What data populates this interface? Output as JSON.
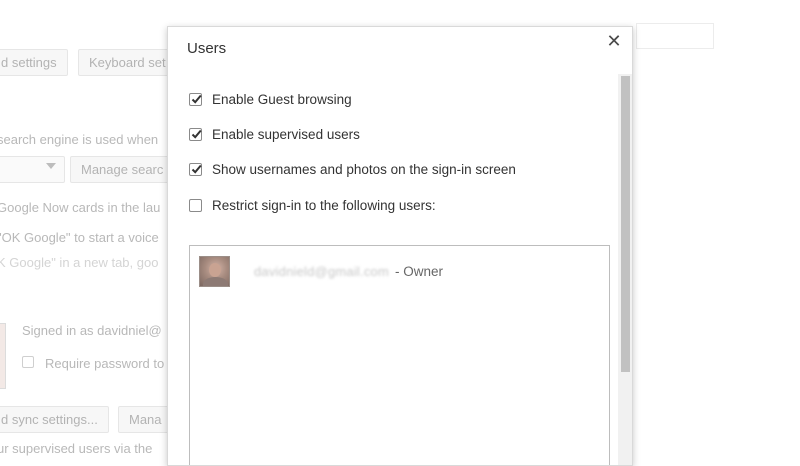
{
  "background": {
    "btn_sync_settings": "d settings",
    "btn_keyboard_settings": "Keyboard set",
    "search_engine_text": "search engine is used when",
    "btn_manage_search": "Manage searc",
    "google_now_text": "Google Now cards in the lau",
    "ok_google_text_1": "\"OK Google\" to start a voice",
    "ok_google_text_2": "K Google\" in a new tab, goo",
    "signed_in_text": "Signed in as davidniel@",
    "require_password_text": "Require password to",
    "btn_advanced_sync": "d sync settings...",
    "btn_manage": "Mana",
    "supervised_text": "ur supervised users via the"
  },
  "dialog": {
    "title": "Users",
    "close_symbol": "✕",
    "options": [
      {
        "label": "Enable Guest browsing",
        "checked": true
      },
      {
        "label": "Enable supervised users",
        "checked": true
      },
      {
        "label": "Show usernames and photos on the sign-in screen",
        "checked": true
      },
      {
        "label": "Restrict sign-in to the following users:",
        "checked": false
      }
    ],
    "users": [
      {
        "email": "davidnield@gmail.com",
        "role": "- Owner"
      }
    ]
  }
}
